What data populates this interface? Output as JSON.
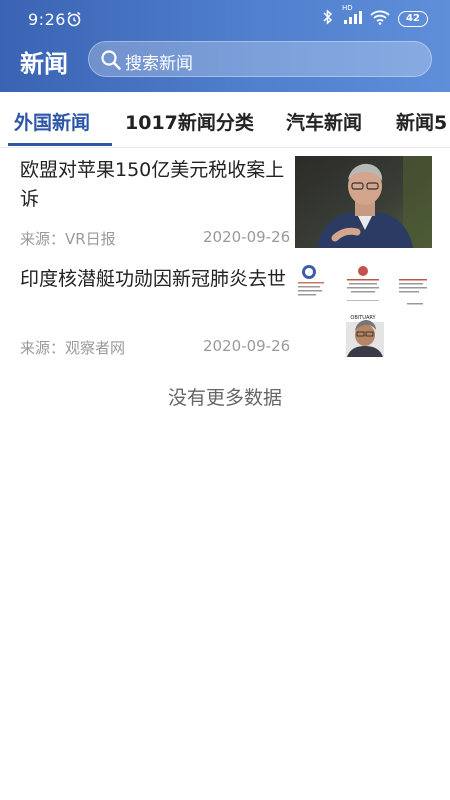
{
  "status": {
    "time": "9:26",
    "battery": "42",
    "network": "HD"
  },
  "header": {
    "title": "新闻",
    "search_placeholder": "搜索新闻"
  },
  "tabs": [
    {
      "label": "外国新闻",
      "active": true
    },
    {
      "label": "1017新闻分类",
      "active": false
    },
    {
      "label": "汽车新闻",
      "active": false
    },
    {
      "label": "新闻5",
      "active": false
    }
  ],
  "news": [
    {
      "title": "欧盟对苹果150亿美元税收案上诉",
      "source": "来源：VR日报",
      "date": "2020-09-26"
    },
    {
      "title": "印度核潜艇功勋因新冠肺炎去世",
      "source": "来源：观察者网",
      "date": "2020-09-26",
      "thumb_caption": "OBITUARY"
    }
  ],
  "footer": {
    "no_more": "没有更多数据"
  },
  "colors": {
    "header": "#3a63b3",
    "accent": "#2d56a6"
  }
}
